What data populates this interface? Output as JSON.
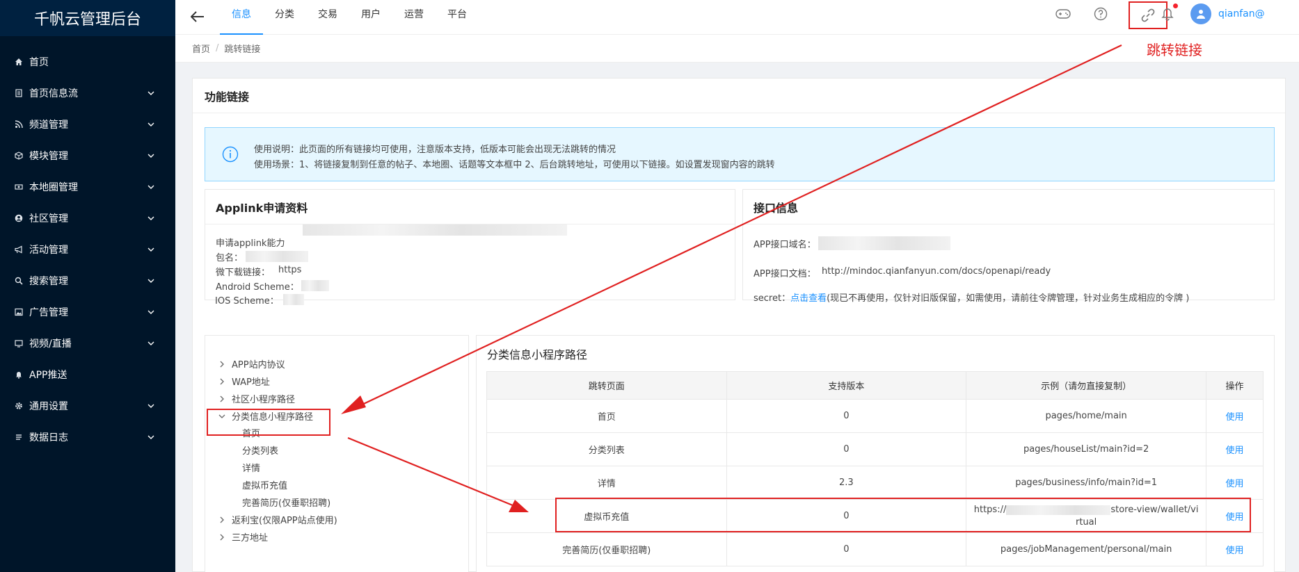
{
  "app": {
    "title": "千帆云管理后台"
  },
  "sidebar": {
    "items": [
      {
        "label": "首页",
        "icon": "home-icon",
        "has_children": false
      },
      {
        "label": "首页信息流",
        "icon": "document-icon",
        "has_children": true
      },
      {
        "label": "频道管理",
        "icon": "rss-icon",
        "has_children": true
      },
      {
        "label": "模块管理",
        "icon": "cube-icon",
        "has_children": true
      },
      {
        "label": "本地圈管理",
        "icon": "money-icon",
        "has_children": true
      },
      {
        "label": "社区管理",
        "icon": "user-circle-icon",
        "has_children": true
      },
      {
        "label": "活动管理",
        "icon": "bullhorn-icon",
        "has_children": true
      },
      {
        "label": "搜索管理",
        "icon": "search-icon",
        "has_children": true
      },
      {
        "label": "广告管理",
        "icon": "picture-icon",
        "has_children": true
      },
      {
        "label": "视频/直播",
        "icon": "monitor-icon",
        "has_children": true
      },
      {
        "label": "APP推送",
        "icon": "bell-icon",
        "has_children": false
      },
      {
        "label": "通用设置",
        "icon": "gear-icon",
        "has_children": true
      },
      {
        "label": "数据日志",
        "icon": "list-icon",
        "has_children": true
      }
    ]
  },
  "header": {
    "tabs": [
      {
        "label": "信息",
        "active": true
      },
      {
        "label": "分类",
        "active": false
      },
      {
        "label": "交易",
        "active": false
      },
      {
        "label": "用户",
        "active": false
      },
      {
        "label": "运营",
        "active": false
      },
      {
        "label": "平台",
        "active": false
      }
    ],
    "username": "qianfan@"
  },
  "breadcrumb": {
    "home": "首页",
    "sep": "/",
    "current": "跳转链接"
  },
  "annotation": {
    "label": "跳转链接"
  },
  "page": {
    "title": "功能链接",
    "notice": {
      "line1": "使用说明：此页面的所有链接均可使用，注意版本支持，低版本可能会出现无法跳转的情况",
      "line2": "使用场景：1、将链接复制到任意的帖子、本地圈、话题等文本框中 2、后台跳转地址，可使用以下链接。如设置发现窗内容的跳转"
    },
    "applink": {
      "title": "Applink申请资料",
      "apply": "申请applink能力",
      "package": "包名：",
      "download": "微下载链接：",
      "download_prefix": "https",
      "android": "Android Scheme：",
      "ios": "IOS Scheme："
    },
    "api": {
      "title": "接口信息",
      "domain": "APP接口域名：",
      "doc_label": "APP接口文档：",
      "doc_url": "http://mindoc.qianfanyun.com/docs/openapi/ready",
      "secret_label": "secret：",
      "secret_link": "点击查看",
      "secret_note": "(现已不再使用，仅针对旧版保留，如需使用，请前往令牌管理，针对业务生成相应的令牌 )"
    },
    "tree": {
      "nodes": [
        {
          "label": "APP站内协议",
          "expanded": false
        },
        {
          "label": "WAP地址",
          "expanded": false
        },
        {
          "label": "社区小程序路径",
          "expanded": false
        },
        {
          "label": "分类信息小程序路径",
          "expanded": true
        },
        {
          "label": "返利宝(仅限APP站点使用)",
          "expanded": false
        },
        {
          "label": "三方地址",
          "expanded": false
        }
      ],
      "children": [
        "首页",
        "分类列表",
        "详情",
        "虚拟币充值",
        "完善简历(仅垂职招聘)"
      ]
    },
    "table": {
      "title": "分类信息小程序路径",
      "headers": [
        "跳转页面",
        "支持版本",
        "示例（请勿直接复制）",
        "操作"
      ],
      "rows": [
        {
          "page": "首页",
          "version": "0",
          "example": "pages/home/main",
          "action": "使用"
        },
        {
          "page": "分类列表",
          "version": "0",
          "example": "pages/houseList/main?id=2",
          "action": "使用"
        },
        {
          "page": "详情",
          "version": "2.3",
          "example": "pages/business/info/main?id=1",
          "action": "使用"
        },
        {
          "page": "虚拟币充值",
          "version": "0",
          "example_prefix": "https://",
          "example_suffix": "store-view/wallet/vi",
          "example_line2": "rtual",
          "action": "使用"
        },
        {
          "page": "完善简历(仅垂职招聘)",
          "version": "0",
          "example": "pages/jobManagement/personal/main",
          "action": "使用"
        }
      ]
    }
  },
  "colors": {
    "sidebar_bg": "#001529",
    "accent": "#1890ff",
    "annotation_red": "#e02020",
    "notice_bg": "#e6f7ff"
  }
}
